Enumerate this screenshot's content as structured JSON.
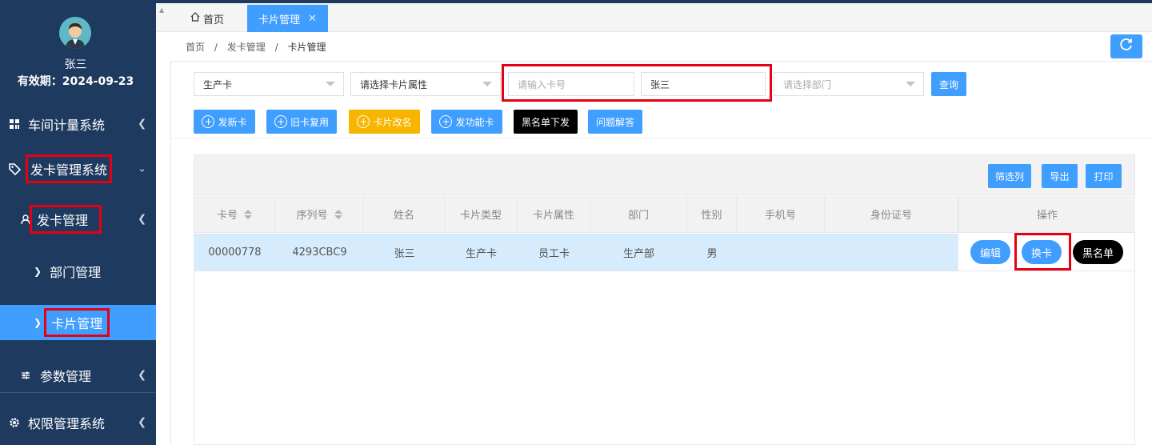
{
  "user": {
    "name": "张三",
    "validity": "有效期：2024-09-23"
  },
  "sidebar": {
    "items": [
      {
        "label": "车间计量系统"
      },
      {
        "label": "发卡管理系统"
      },
      {
        "label": "发卡管理"
      },
      {
        "label": "部门管理"
      },
      {
        "label": "卡片管理"
      },
      {
        "label": "参数管理"
      },
      {
        "label": "权限管理系统"
      }
    ]
  },
  "tabs": [
    {
      "label": "首页"
    },
    {
      "label": "卡片管理"
    }
  ],
  "breadcrumb": [
    "首页",
    "/",
    "发卡管理",
    "/",
    "卡片管理"
  ],
  "filters": {
    "card_type": "生产卡",
    "card_attr_placeholder": "请选择卡片属性",
    "card_no_placeholder": "请输入卡号",
    "name_value": "张三",
    "dept_placeholder": "请选择部门",
    "query_label": "查询"
  },
  "actions": {
    "new_card": "发新卡",
    "reuse_card": "旧卡复用",
    "rename_card": "卡片改名",
    "func_card": "发功能卡",
    "blacklist_issue": "黑名单下发",
    "faq": "问题解答"
  },
  "toolbar": {
    "filter_cols": "筛选列",
    "export": "导出",
    "print": "打印"
  },
  "table": {
    "headers": [
      "卡号",
      "序列号",
      "姓名",
      "卡片类型",
      "卡片属性",
      "部门",
      "性别",
      "手机号",
      "身份证号",
      "操作"
    ],
    "rows": [
      {
        "card_no": "00000778",
        "serial": "4293CBC9",
        "name": "张三",
        "type": "生产卡",
        "attr": "员工卡",
        "dept": "生产部",
        "gender": "男",
        "phone": "",
        "id_no": ""
      }
    ],
    "row_actions": {
      "edit": "编辑",
      "replace": "换卡",
      "blacklist": "黑名单"
    }
  },
  "colors": {
    "sidebar": "#1e3a5f",
    "primary": "#409eff",
    "warning": "#f7b500",
    "highlight": "#e60012"
  }
}
